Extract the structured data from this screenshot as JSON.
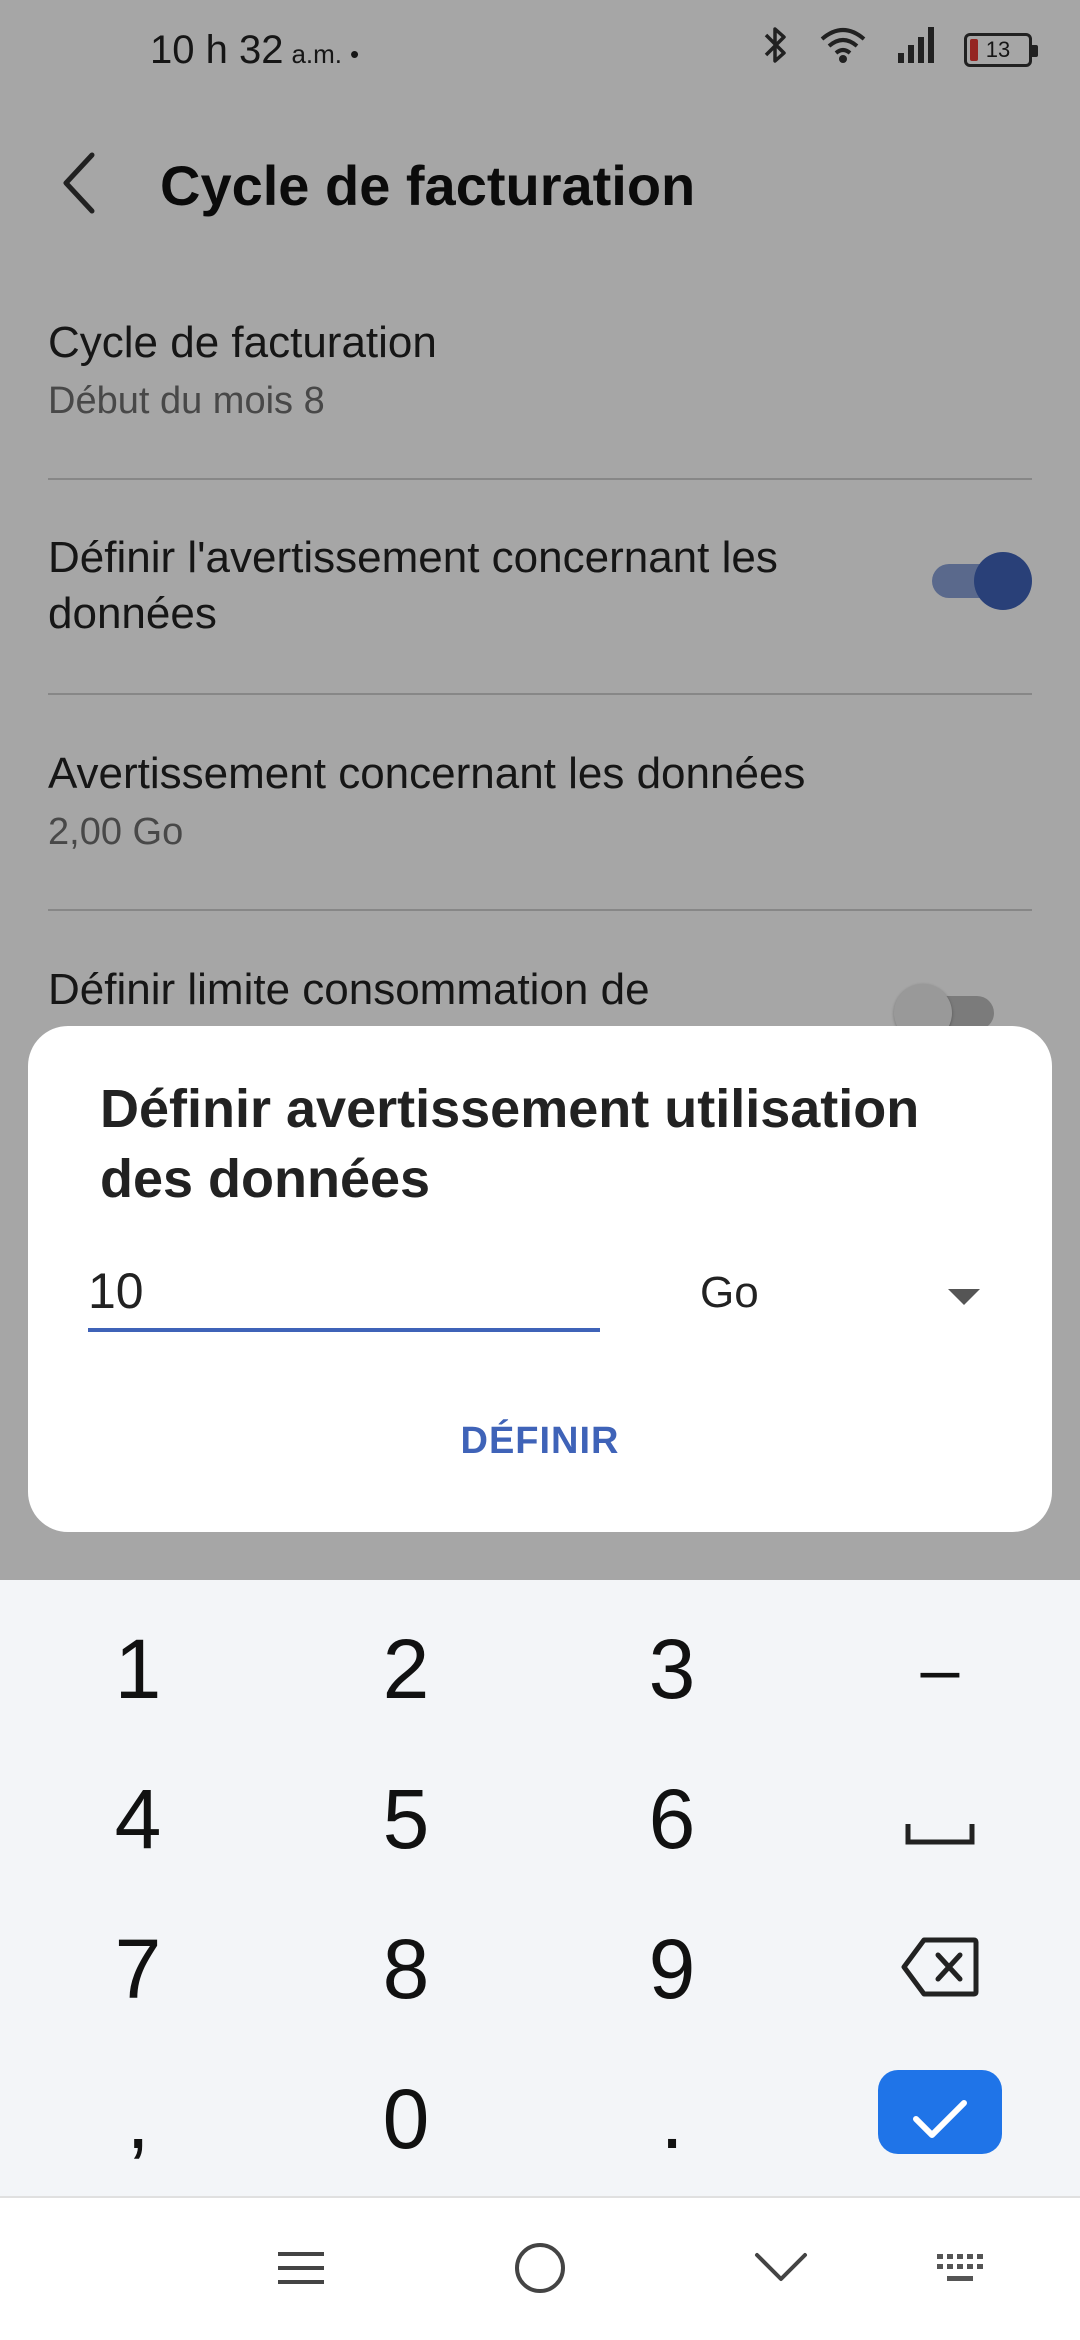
{
  "status_bar": {
    "time": "10 h 32",
    "ampm": "a.m.",
    "dot": "•",
    "battery": "13"
  },
  "appbar": {
    "title": "Cycle de facturation"
  },
  "settings": {
    "billing_cycle": {
      "title": "Cycle de facturation",
      "subtitle": "Début du mois 8"
    },
    "set_data_warning": {
      "title": "Définir l'avertissement concernant les données",
      "enabled": true
    },
    "data_warning": {
      "title": "Avertissement concernant les données",
      "subtitle": "2,00 Go"
    },
    "set_data_limit": {
      "title": "Définir limite consommation de",
      "enabled": false
    }
  },
  "dialog": {
    "title": "Définir avertissement utilisation des données",
    "input_value": "10",
    "unit_selected": "Go",
    "action_label": "DÉFINIR"
  },
  "keyboard": {
    "rows": [
      [
        "1",
        "2",
        "3",
        "–"
      ],
      [
        "4",
        "5",
        "6",
        "space"
      ],
      [
        "7",
        "8",
        "9",
        "backspace"
      ],
      [
        ",",
        "0",
        ".",
        "enter"
      ]
    ]
  },
  "colors": {
    "accent": "#3f63b8",
    "enter_key": "#1f74e8",
    "battery_low": "#e53935"
  },
  "icons": {
    "back": "chevron-left-icon",
    "bluetooth": "bluetooth-icon",
    "wifi": "wifi-icon",
    "signal": "signal-icon",
    "dropdown": "caret-down-icon",
    "nav_menu": "menu-icon",
    "nav_home": "home-circle-icon",
    "nav_hide_keyboard": "chevron-down-icon",
    "nav_keyboard": "keyboard-icon"
  }
}
